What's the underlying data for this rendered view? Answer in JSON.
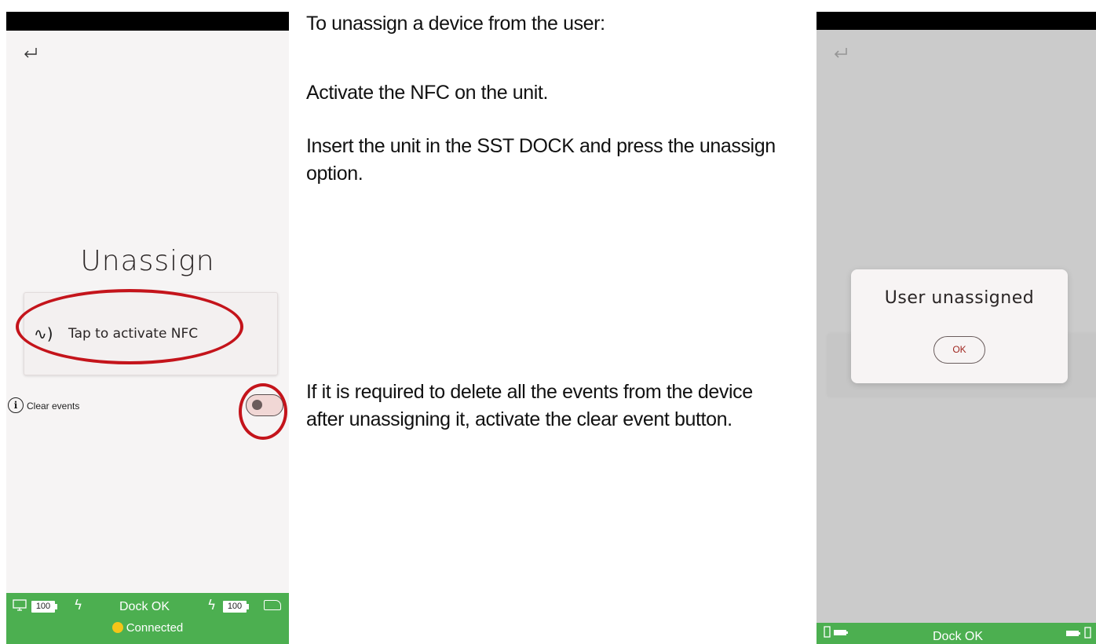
{
  "left_screen": {
    "title": "Unassign",
    "nfc_button_label": "Tap to activate NFC",
    "clear_events_label": "Clear events",
    "clear_events_toggle": false,
    "bottom_bar": {
      "left_battery": "100",
      "dock_status": "Dock OK",
      "right_battery": "100",
      "connection_status": "Connected"
    }
  },
  "instructions": {
    "line1": "To unassign a device from the user:",
    "line2": "Activate the NFC on the unit.",
    "line3": "Insert the unit in the SST DOCK and press the unassign option.",
    "line4": "If it is required to delete all the events from the device after unassigning it, activate the clear event button."
  },
  "right_screen": {
    "dialog_message": "User unassigned",
    "ok_label": "OK",
    "dock_status": "Dock OK"
  },
  "colors": {
    "status_green": "#4caf50",
    "highlight_red": "#c4141b",
    "ok_text": "#a0261f"
  }
}
